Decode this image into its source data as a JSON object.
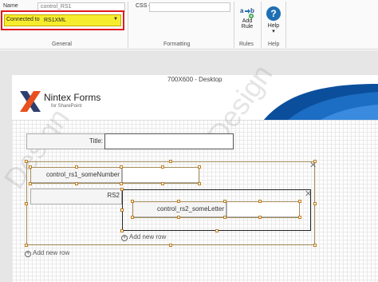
{
  "ribbon": {
    "name_label": "Name",
    "name_value": "control_RS1",
    "css_label": "CSS class",
    "css_value": "",
    "connected_label": "Connected to :",
    "connected_value": "RS1XML",
    "groups": {
      "general": "General",
      "formatting": "Formatting",
      "rules": "Rules",
      "help": "Help"
    },
    "add_rule_label_1": "Add",
    "add_rule_label_2": "Rule",
    "help_label": "Help",
    "help_dropdown": "▾"
  },
  "canvas": {
    "stage_title": "700X600 - Desktop",
    "logo_brand": "Nintex Forms",
    "logo_sub": "for SharePoint",
    "title_label": "Title:",
    "rs1_label": "control_rs1_someNumber",
    "rs2_label": "RS2",
    "rs2_inner_label": "control_rs2_someLetter",
    "add_row_inner": "Add new row",
    "add_row_outer": "Add new row",
    "close_glyph": "✕",
    "watermark": "Design"
  },
  "colors": {
    "highlight_yellow": "#f6ec2e",
    "highlight_red": "#e01b1b",
    "brand_blue": "#0b4f9c",
    "logo_orange": "#e8501e"
  }
}
